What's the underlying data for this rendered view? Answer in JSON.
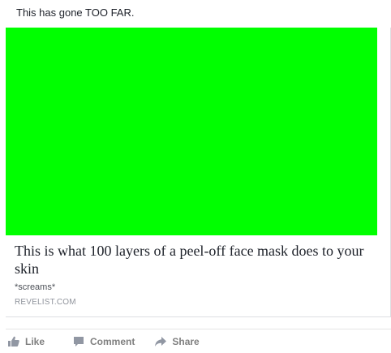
{
  "post": {
    "text": "This has gone TOO FAR.",
    "link_card": {
      "image_color": "#00ff00",
      "title": "This is what 100 layers of a peel-off face mask does to your skin",
      "description": "*screams*",
      "domain": "REVELIST.COM"
    }
  },
  "actions": {
    "like": "Like",
    "comment": "Comment",
    "share": "Share"
  },
  "colors": {
    "action_text": "#7f7f7f",
    "border": "#dddfe2"
  }
}
